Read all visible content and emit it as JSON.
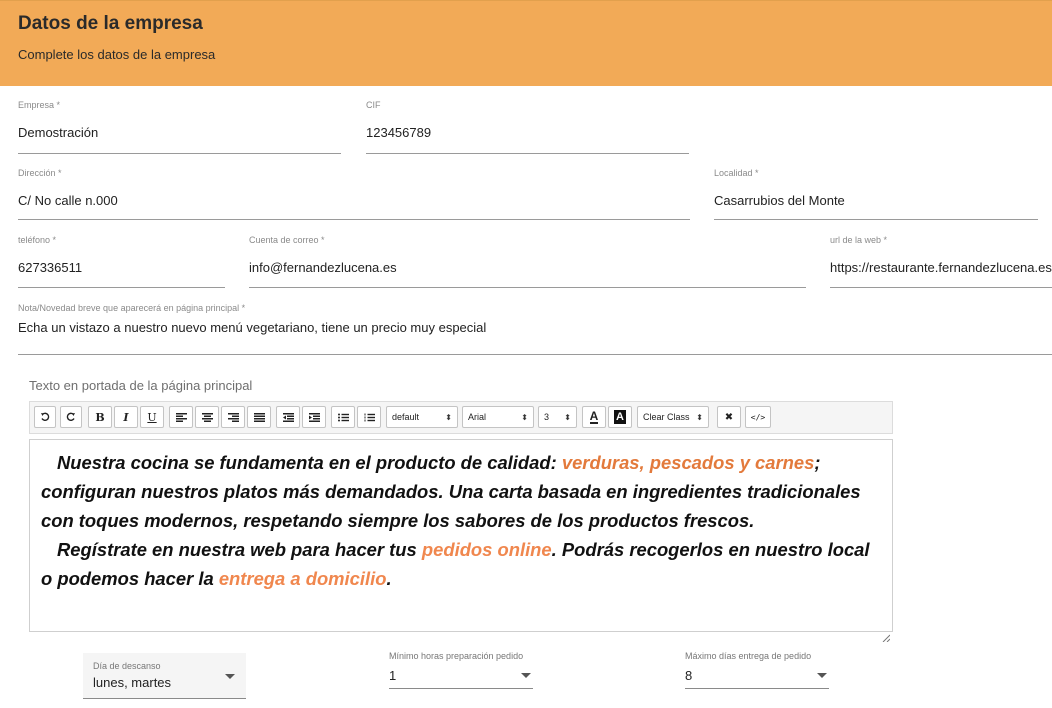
{
  "header": {
    "title": "Datos de la empresa",
    "subtitle": "Complete los datos de la empresa",
    "background": "#f2aa57"
  },
  "fields": {
    "empresa": {
      "label": "Empresa *",
      "value": "Demostración"
    },
    "cif": {
      "label": "CIF",
      "value": "123456789"
    },
    "direccion": {
      "label": "Dirección *",
      "value": "C/ No calle n.000"
    },
    "localidad": {
      "label": "Localidad *",
      "value": "Casarrubios del Monte"
    },
    "telefono": {
      "label": "teléfono *",
      "value": "627336511"
    },
    "correo": {
      "label": "Cuenta de correo *",
      "value": "info@fernandezlucena.es"
    },
    "url": {
      "label": "url de la web *",
      "value": "https://restaurante.fernandezlucena.es"
    },
    "nota": {
      "label": "Nota/Novedad breve que aparecerá en página principal *",
      "value": "Echa un vistazo a nuestro nuevo menú vegetariano, tiene un precio muy especial"
    }
  },
  "editor": {
    "label": "Texto en portada de la página principal",
    "toolbar": {
      "undo_icon": "undo-icon",
      "redo_icon": "redo-icon",
      "bold": "B",
      "italic": "I",
      "underline": "U",
      "style_select": "default",
      "font_select": "Arial",
      "size_select": "3",
      "font_color": "A",
      "bg_color": "A",
      "clear_class": "Clear Class",
      "remove_format": "✖",
      "code_view": "</>"
    },
    "paragraph1": {
      "t1": "Nuestra cocina se fundamenta en el producto de calidad: ",
      "hl": "verduras, pescados y carnes",
      "t2": "; configuran nuestros platos más demandados. Una carta basada en ingredientes tradicionales con toques modernos, respetando siempre los sabores de los productos frescos."
    },
    "paragraph2": {
      "t1": "Regístrate en nuestra web para hacer tus ",
      "hl1": "pedidos online",
      "t2": ". Podrás recogerlos en nuestro local o podemos hacer la ",
      "hl2": "entrega a domicilio",
      "t3": "."
    },
    "accent_color": "#e37a3c"
  },
  "selects": {
    "descanso": {
      "label": "Día de descanso",
      "value": "lunes, martes"
    },
    "horas": {
      "label": "Mínimo horas preparación pedido",
      "value": "1"
    },
    "dias": {
      "label": "Máximo días entrega de pedido",
      "value": "8"
    }
  }
}
